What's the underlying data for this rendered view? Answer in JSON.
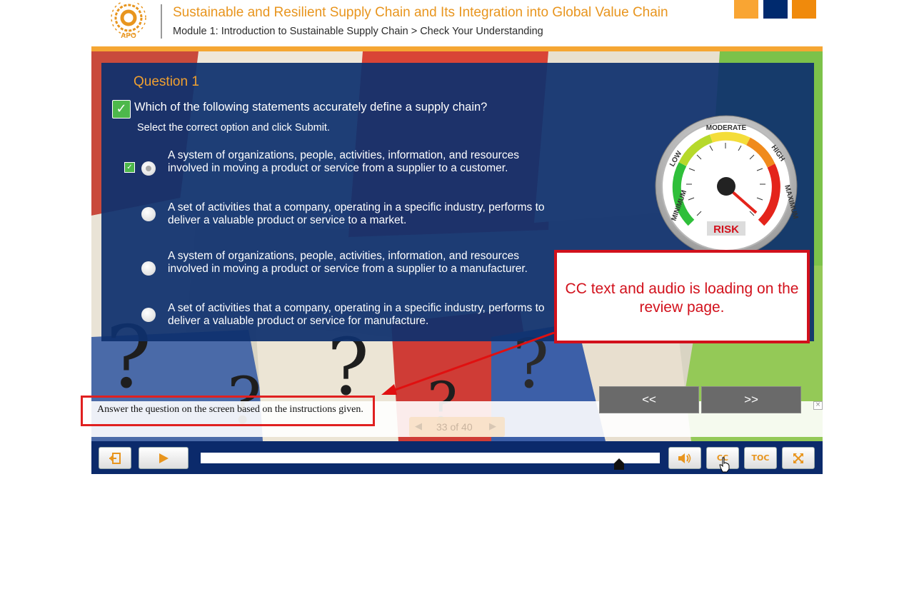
{
  "header": {
    "logo_text": "APO",
    "course_title": "Sustainable and Resilient Supply Chain and Its Integration into Global Value Chain",
    "breadcrumb": "Module 1: Introduction to Sustainable Supply Chain > Check Your Understanding",
    "swatch_colors": [
      "#f9a533",
      "#002a6e",
      "#f08a0c"
    ]
  },
  "question": {
    "number_label": "Question 1",
    "text": "Which of the following statements accurately define a supply chain?",
    "instruction": "Select the correct option and click Submit.",
    "options": [
      {
        "text": "A system of organizations, people, activities, information, and resources involved in moving a product or service from a supplier to a customer.",
        "selected": true,
        "marked_correct": true
      },
      {
        "text": "A set of activities that a company, operating in a specific industry, performs to deliver a valuable product or service to a market.",
        "selected": false,
        "marked_correct": false
      },
      {
        "text": "A system of organizations, people, activities, information, and resources involved in moving a product or service from a supplier to a manufacturer.",
        "selected": false,
        "marked_correct": false
      },
      {
        "text": "A set of activities that a company, operating in a specific industry, performs to deliver a valuable product or service for manufacture.",
        "selected": false,
        "marked_correct": false
      }
    ]
  },
  "gauge": {
    "labels": [
      "MINIMUM",
      "LOW",
      "MODERATE",
      "HIGH",
      "MAXIMUM"
    ],
    "caption": "RISK"
  },
  "callout": {
    "text": "CC text and audio is loading on the review page."
  },
  "nav": {
    "prev_label": "<<",
    "next_label": ">>"
  },
  "pager": {
    "text": "33 of 40"
  },
  "captions": {
    "text": "Answer the question on the screen based on the instructions given.",
    "close_label": "×"
  },
  "controls": {
    "exit_icon": "exit-icon",
    "play_icon": "play-icon",
    "audio_icon": "speaker-icon",
    "cc_label": "CC",
    "toc_label": "TOC",
    "fullscreen_icon": "expand-icon"
  }
}
